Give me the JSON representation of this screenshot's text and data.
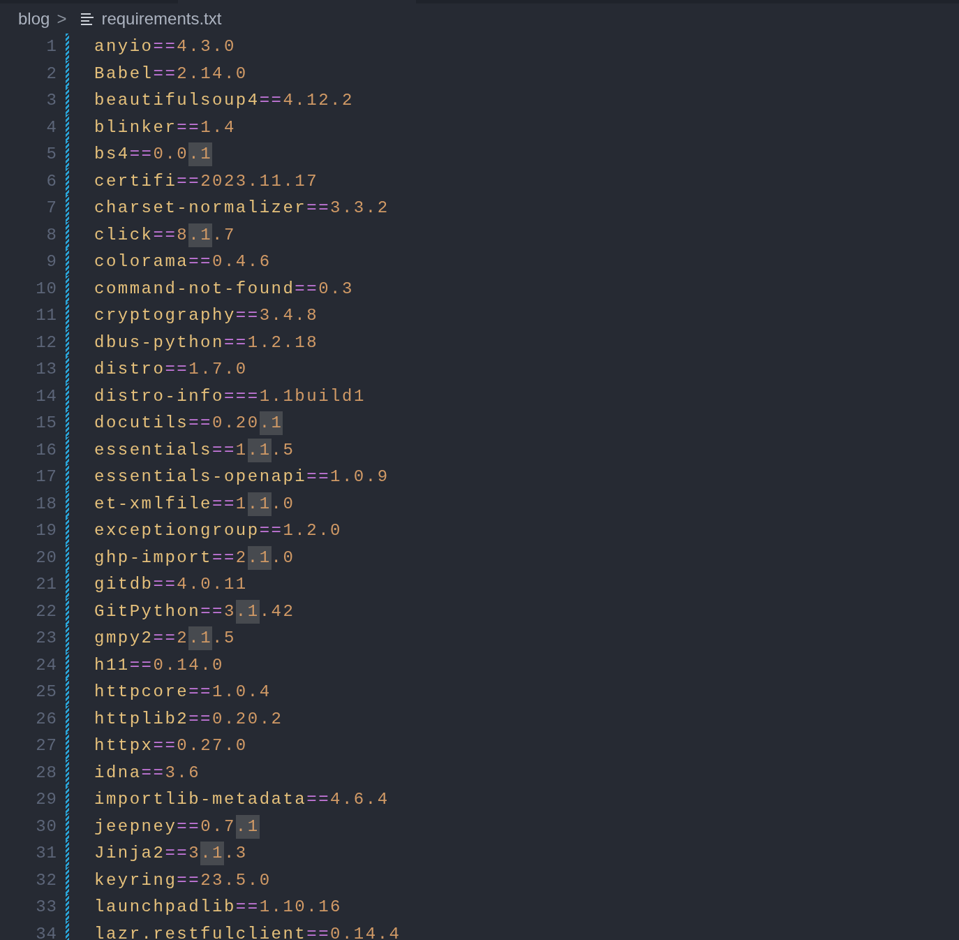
{
  "breadcrumb": {
    "folder": "blog",
    "separator": ">",
    "file": "requirements.txt"
  },
  "lines": [
    {
      "number": "1",
      "tokens": [
        {
          "kind": "name",
          "text": "anyio",
          "highlighted": false
        },
        {
          "kind": "operator",
          "text": "==",
          "highlighted": false
        },
        {
          "kind": "number",
          "text": "4.3.0",
          "highlighted": false
        }
      ]
    },
    {
      "number": "2",
      "tokens": [
        {
          "kind": "name",
          "text": "Babel",
          "highlighted": false
        },
        {
          "kind": "operator",
          "text": "==",
          "highlighted": false
        },
        {
          "kind": "number",
          "text": "2.14.0",
          "highlighted": false
        }
      ]
    },
    {
      "number": "3",
      "tokens": [
        {
          "kind": "name",
          "text": "beautifulsoup4",
          "highlighted": false
        },
        {
          "kind": "operator",
          "text": "==",
          "highlighted": false
        },
        {
          "kind": "number",
          "text": "4.12.2",
          "highlighted": false
        }
      ]
    },
    {
      "number": "4",
      "tokens": [
        {
          "kind": "name",
          "text": "blinker",
          "highlighted": false
        },
        {
          "kind": "operator",
          "text": "==",
          "highlighted": false
        },
        {
          "kind": "number",
          "text": "1.4",
          "highlighted": false
        }
      ]
    },
    {
      "number": "5",
      "tokens": [
        {
          "kind": "name",
          "text": "bs4",
          "highlighted": false
        },
        {
          "kind": "operator",
          "text": "==",
          "highlighted": false
        },
        {
          "kind": "number",
          "text": "0.0",
          "highlighted": false
        },
        {
          "kind": "number",
          "text": ".1",
          "highlighted": true
        }
      ]
    },
    {
      "number": "6",
      "tokens": [
        {
          "kind": "name",
          "text": "certifi",
          "highlighted": false
        },
        {
          "kind": "operator",
          "text": "==",
          "highlighted": false
        },
        {
          "kind": "number",
          "text": "2023.11.17",
          "highlighted": false
        }
      ]
    },
    {
      "number": "7",
      "tokens": [
        {
          "kind": "name",
          "text": "charset-normalizer",
          "highlighted": false
        },
        {
          "kind": "operator",
          "text": "==",
          "highlighted": false
        },
        {
          "kind": "number",
          "text": "3.3.2",
          "highlighted": false
        }
      ]
    },
    {
      "number": "8",
      "tokens": [
        {
          "kind": "name",
          "text": "click",
          "highlighted": false
        },
        {
          "kind": "operator",
          "text": "==",
          "highlighted": false
        },
        {
          "kind": "number",
          "text": "8",
          "highlighted": false
        },
        {
          "kind": "number",
          "text": ".1",
          "highlighted": true
        },
        {
          "kind": "number",
          "text": ".7",
          "highlighted": false
        }
      ]
    },
    {
      "number": "9",
      "tokens": [
        {
          "kind": "name",
          "text": "colorama",
          "highlighted": false
        },
        {
          "kind": "operator",
          "text": "==",
          "highlighted": false
        },
        {
          "kind": "number",
          "text": "0.4.6",
          "highlighted": false
        }
      ]
    },
    {
      "number": "10",
      "tokens": [
        {
          "kind": "name",
          "text": "command-not-found",
          "highlighted": false
        },
        {
          "kind": "operator",
          "text": "==",
          "highlighted": false
        },
        {
          "kind": "number",
          "text": "0.3",
          "highlighted": false
        }
      ]
    },
    {
      "number": "11",
      "tokens": [
        {
          "kind": "name",
          "text": "cryptography",
          "highlighted": false
        },
        {
          "kind": "operator",
          "text": "==",
          "highlighted": false
        },
        {
          "kind": "number",
          "text": "3.4.8",
          "highlighted": false
        }
      ]
    },
    {
      "number": "12",
      "tokens": [
        {
          "kind": "name",
          "text": "dbus-python",
          "highlighted": false
        },
        {
          "kind": "operator",
          "text": "==",
          "highlighted": false
        },
        {
          "kind": "number",
          "text": "1.2.18",
          "highlighted": false
        }
      ]
    },
    {
      "number": "13",
      "tokens": [
        {
          "kind": "name",
          "text": "distro",
          "highlighted": false
        },
        {
          "kind": "operator",
          "text": "==",
          "highlighted": false
        },
        {
          "kind": "number",
          "text": "1.7.0",
          "highlighted": false
        }
      ]
    },
    {
      "number": "14",
      "tokens": [
        {
          "kind": "name",
          "text": "distro-info",
          "highlighted": false
        },
        {
          "kind": "operator",
          "text": "===",
          "highlighted": false
        },
        {
          "kind": "number",
          "text": "1.1build1",
          "highlighted": false
        }
      ]
    },
    {
      "number": "15",
      "tokens": [
        {
          "kind": "name",
          "text": "docutils",
          "highlighted": false
        },
        {
          "kind": "operator",
          "text": "==",
          "highlighted": false
        },
        {
          "kind": "number",
          "text": "0.20",
          "highlighted": false
        },
        {
          "kind": "number",
          "text": ".1",
          "highlighted": true
        }
      ]
    },
    {
      "number": "16",
      "tokens": [
        {
          "kind": "name",
          "text": "essentials",
          "highlighted": false
        },
        {
          "kind": "operator",
          "text": "==",
          "highlighted": false
        },
        {
          "kind": "number",
          "text": "1",
          "highlighted": false
        },
        {
          "kind": "number",
          "text": ".1",
          "highlighted": true
        },
        {
          "kind": "number",
          "text": ".5",
          "highlighted": false
        }
      ]
    },
    {
      "number": "17",
      "tokens": [
        {
          "kind": "name",
          "text": "essentials-openapi",
          "highlighted": false
        },
        {
          "kind": "operator",
          "text": "==",
          "highlighted": false
        },
        {
          "kind": "number",
          "text": "1.0.9",
          "highlighted": false
        }
      ]
    },
    {
      "number": "18",
      "tokens": [
        {
          "kind": "name",
          "text": "et-xmlfile",
          "highlighted": false
        },
        {
          "kind": "operator",
          "text": "==",
          "highlighted": false
        },
        {
          "kind": "number",
          "text": "1",
          "highlighted": false
        },
        {
          "kind": "number",
          "text": ".1",
          "highlighted": true
        },
        {
          "kind": "number",
          "text": ".0",
          "highlighted": false
        }
      ]
    },
    {
      "number": "19",
      "tokens": [
        {
          "kind": "name",
          "text": "exceptiongroup",
          "highlighted": false
        },
        {
          "kind": "operator",
          "text": "==",
          "highlighted": false
        },
        {
          "kind": "number",
          "text": "1.2.0",
          "highlighted": false
        }
      ]
    },
    {
      "number": "20",
      "tokens": [
        {
          "kind": "name",
          "text": "ghp-import",
          "highlighted": false
        },
        {
          "kind": "operator",
          "text": "==",
          "highlighted": false
        },
        {
          "kind": "number",
          "text": "2",
          "highlighted": false
        },
        {
          "kind": "number",
          "text": ".1",
          "highlighted": true
        },
        {
          "kind": "number",
          "text": ".0",
          "highlighted": false
        }
      ]
    },
    {
      "number": "21",
      "tokens": [
        {
          "kind": "name",
          "text": "gitdb",
          "highlighted": false
        },
        {
          "kind": "operator",
          "text": "==",
          "highlighted": false
        },
        {
          "kind": "number",
          "text": "4.0.11",
          "highlighted": false
        }
      ]
    },
    {
      "number": "22",
      "tokens": [
        {
          "kind": "name",
          "text": "GitPython",
          "highlighted": false
        },
        {
          "kind": "operator",
          "text": "==",
          "highlighted": false
        },
        {
          "kind": "number",
          "text": "3",
          "highlighted": false
        },
        {
          "kind": "number",
          "text": ".1",
          "highlighted": true
        },
        {
          "kind": "number",
          "text": ".42",
          "highlighted": false
        }
      ]
    },
    {
      "number": "23",
      "tokens": [
        {
          "kind": "name",
          "text": "gmpy2",
          "highlighted": false
        },
        {
          "kind": "operator",
          "text": "==",
          "highlighted": false
        },
        {
          "kind": "number",
          "text": "2",
          "highlighted": false
        },
        {
          "kind": "number",
          "text": ".1",
          "highlighted": true
        },
        {
          "kind": "number",
          "text": ".5",
          "highlighted": false
        }
      ]
    },
    {
      "number": "24",
      "tokens": [
        {
          "kind": "name",
          "text": "h11",
          "highlighted": false
        },
        {
          "kind": "operator",
          "text": "==",
          "highlighted": false
        },
        {
          "kind": "number",
          "text": "0.14.0",
          "highlighted": false
        }
      ]
    },
    {
      "number": "25",
      "tokens": [
        {
          "kind": "name",
          "text": "httpcore",
          "highlighted": false
        },
        {
          "kind": "operator",
          "text": "==",
          "highlighted": false
        },
        {
          "kind": "number",
          "text": "1.0.4",
          "highlighted": false
        }
      ]
    },
    {
      "number": "26",
      "tokens": [
        {
          "kind": "name",
          "text": "httplib2",
          "highlighted": false
        },
        {
          "kind": "operator",
          "text": "==",
          "highlighted": false
        },
        {
          "kind": "number",
          "text": "0.20.2",
          "highlighted": false
        }
      ]
    },
    {
      "number": "27",
      "tokens": [
        {
          "kind": "name",
          "text": "httpx",
          "highlighted": false
        },
        {
          "kind": "operator",
          "text": "==",
          "highlighted": false
        },
        {
          "kind": "number",
          "text": "0.27.0",
          "highlighted": false
        }
      ]
    },
    {
      "number": "28",
      "tokens": [
        {
          "kind": "name",
          "text": "idna",
          "highlighted": false
        },
        {
          "kind": "operator",
          "text": "==",
          "highlighted": false
        },
        {
          "kind": "number",
          "text": "3.6",
          "highlighted": false
        }
      ]
    },
    {
      "number": "29",
      "tokens": [
        {
          "kind": "name",
          "text": "importlib-metadata",
          "highlighted": false
        },
        {
          "kind": "operator",
          "text": "==",
          "highlighted": false
        },
        {
          "kind": "number",
          "text": "4.6.4",
          "highlighted": false
        }
      ]
    },
    {
      "number": "30",
      "tokens": [
        {
          "kind": "name",
          "text": "jeepney",
          "highlighted": false
        },
        {
          "kind": "operator",
          "text": "==",
          "highlighted": false
        },
        {
          "kind": "number",
          "text": "0.7",
          "highlighted": false
        },
        {
          "kind": "number",
          "text": ".1",
          "highlighted": true
        }
      ]
    },
    {
      "number": "31",
      "tokens": [
        {
          "kind": "name",
          "text": "Jinja2",
          "highlighted": false
        },
        {
          "kind": "operator",
          "text": "==",
          "highlighted": false
        },
        {
          "kind": "number",
          "text": "3",
          "highlighted": false
        },
        {
          "kind": "number",
          "text": ".1",
          "highlighted": true
        },
        {
          "kind": "number",
          "text": ".3",
          "highlighted": false
        }
      ]
    },
    {
      "number": "32",
      "tokens": [
        {
          "kind": "name",
          "text": "keyring",
          "highlighted": false
        },
        {
          "kind": "operator",
          "text": "==",
          "highlighted": false
        },
        {
          "kind": "number",
          "text": "23.5.0",
          "highlighted": false
        }
      ]
    },
    {
      "number": "33",
      "tokens": [
        {
          "kind": "name",
          "text": "launchpadlib",
          "highlighted": false
        },
        {
          "kind": "operator",
          "text": "==",
          "highlighted": false
        },
        {
          "kind": "number",
          "text": "1.10.16",
          "highlighted": false
        }
      ]
    },
    {
      "number": "34",
      "tokens": [
        {
          "kind": "name",
          "text": "lazr.restfulclient",
          "highlighted": false
        },
        {
          "kind": "operator",
          "text": "==",
          "highlighted": false
        },
        {
          "kind": "number",
          "text": "0.14.4",
          "highlighted": false
        }
      ]
    }
  ]
}
